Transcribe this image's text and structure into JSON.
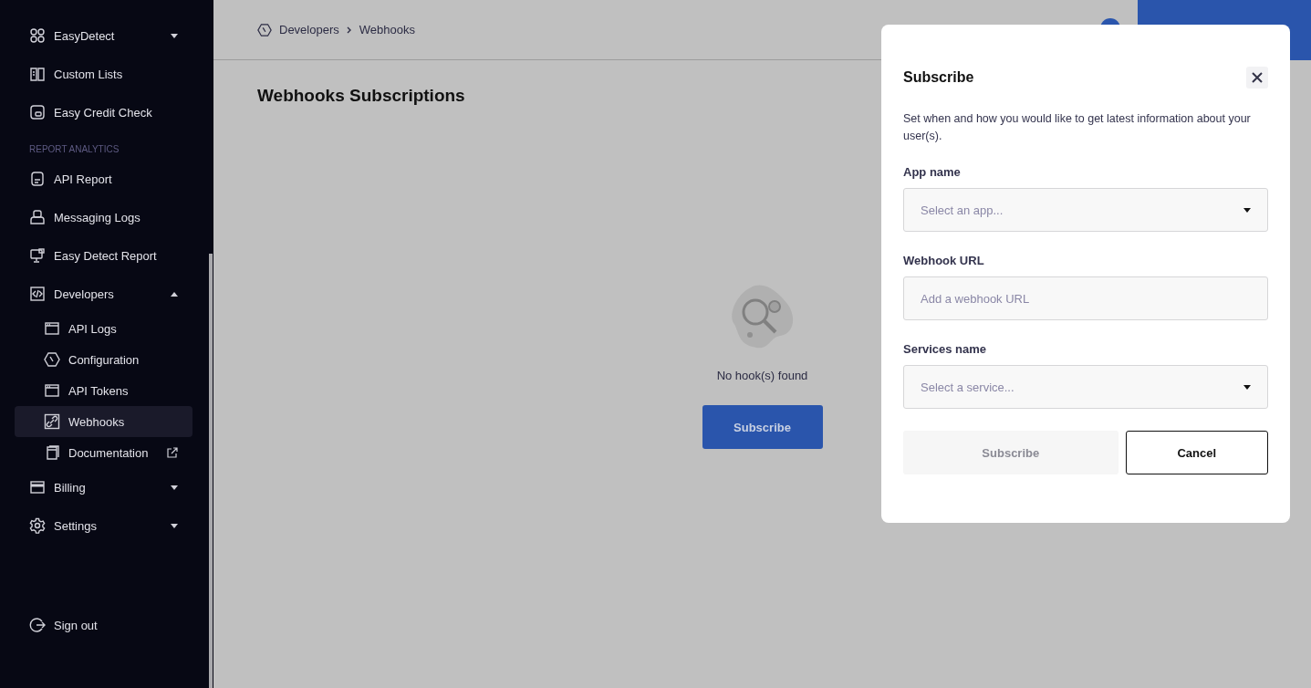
{
  "sidebar": {
    "sections": [
      {
        "items": [
          {
            "label": "EasyDetect",
            "kind": "group",
            "expanded": false,
            "selected": false
          },
          {
            "label": "Custom Lists",
            "kind": "page",
            "selected": false
          },
          {
            "label": "Easy Credit Check",
            "kind": "page",
            "selected": false
          }
        ]
      },
      {
        "label": "REPORT ANALYTICS",
        "items": [
          {
            "label": "API Report",
            "kind": "page",
            "selected": false
          },
          {
            "label": "Messaging Logs",
            "kind": "page",
            "selected": false
          },
          {
            "label": "Easy Detect Report",
            "kind": "page",
            "selected": false
          }
        ]
      },
      {
        "items": [
          {
            "label": "Developers",
            "kind": "group",
            "expanded": true,
            "selected": false,
            "children": [
              {
                "label": "API Logs",
                "kind": "page",
                "selected": false
              },
              {
                "label": "Configuration",
                "kind": "page",
                "selected": false
              },
              {
                "label": "API Tokens",
                "kind": "page",
                "selected": false
              },
              {
                "label": "Webhooks",
                "kind": "page",
                "selected": true
              },
              {
                "label": "Documentation",
                "kind": "external",
                "selected": false
              }
            ]
          },
          {
            "label": "Billing",
            "kind": "group",
            "expanded": false,
            "selected": false
          },
          {
            "label": "Settings",
            "kind": "group",
            "expanded": false,
            "selected": false
          }
        ]
      }
    ],
    "sign_out": {
      "label": "Sign out"
    }
  },
  "breadcrumb": [
    "Developers",
    "Webhooks"
  ],
  "page_title": "Webhooks Subscriptions",
  "empty_state": {
    "message": "No hook(s) found",
    "button": "Subscribe"
  },
  "modal": {
    "title": "Subscribe",
    "description": "Set when and how you would like to get latest information about your user(s).",
    "fields": [
      {
        "label": "App name",
        "kind": "select",
        "placeholder": "Select an app..."
      },
      {
        "label": "Webhook URL",
        "kind": "text",
        "placeholder": "Add a webhook URL"
      },
      {
        "label": "Services name",
        "kind": "select",
        "placeholder": "Select a service..."
      }
    ],
    "buttons": [
      {
        "label": "Subscribe",
        "kind": "primary",
        "disabled": true
      },
      {
        "label": "Cancel",
        "kind": "secondary",
        "disabled": false
      }
    ]
  }
}
